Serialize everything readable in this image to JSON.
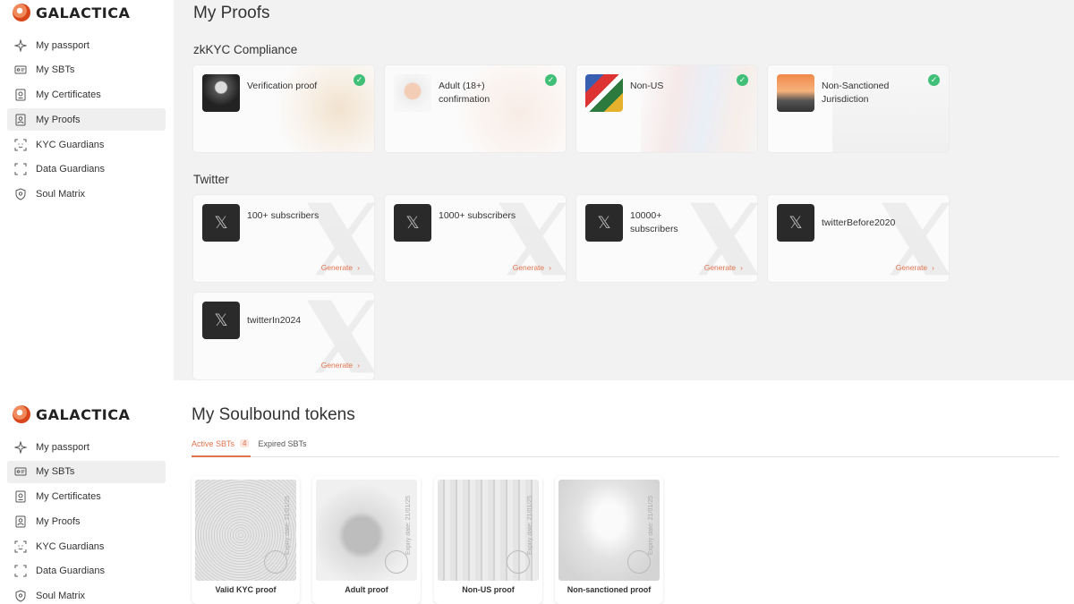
{
  "brand": {
    "name": "GALACTICA"
  },
  "nav": [
    {
      "label": "My passport",
      "icon": "sparkle-icon"
    },
    {
      "label": "My SBTs",
      "icon": "id-card-icon"
    },
    {
      "label": "My Certificates",
      "icon": "certificate-icon"
    },
    {
      "label": "My Proofs",
      "icon": "proof-icon"
    },
    {
      "label": "KYC Guardians",
      "icon": "face-scan-icon"
    },
    {
      "label": "Data Guardians",
      "icon": "scan-frame-icon"
    },
    {
      "label": "Soul Matrix",
      "icon": "shield-icon"
    }
  ],
  "proofs_page": {
    "title": "My Proofs",
    "active_nav": "My Proofs",
    "kyc_section": {
      "title": "zkKYC Compliance",
      "cards": [
        {
          "label": "Verification proof",
          "verified": true
        },
        {
          "label": "Adult (18+) confirmation",
          "verified": true
        },
        {
          "label": "Non-US",
          "verified": true
        },
        {
          "label": "Non-Sanctioned Jurisdiction",
          "verified": true
        }
      ]
    },
    "twitter_section": {
      "title": "Twitter",
      "cards": [
        {
          "label": "100+ subscribers",
          "action": "Generate"
        },
        {
          "label": "1000+ subscribers",
          "action": "Generate"
        },
        {
          "label": "10000+ subscribers",
          "action": "Generate"
        },
        {
          "label": "twitterBefore2020",
          "action": "Generate"
        },
        {
          "label": "twitterIn2024",
          "action": "Generate"
        }
      ]
    }
  },
  "sbt_page": {
    "title": "My Soulbound tokens",
    "active_nav": "My SBTs",
    "tabs": [
      {
        "label": "Active SBTs",
        "count": "4",
        "active": true
      },
      {
        "label": "Expired SBTs",
        "active": false
      }
    ],
    "tokens": [
      {
        "label": "Valid KYC proof",
        "expiry": "Expiry date: 21/01/25"
      },
      {
        "label": "Adult proof",
        "expiry": "Expiry date: 21/01/25"
      },
      {
        "label": "Non-US proof",
        "expiry": "Expiry date: 21/01/25"
      },
      {
        "label": "Non-sanctioned proof",
        "expiry": "Expiry date: 21/01/25"
      }
    ]
  },
  "colors": {
    "accent": "#e0734f",
    "check": "#3fbf77",
    "main_bg": "#f2f2f2"
  }
}
